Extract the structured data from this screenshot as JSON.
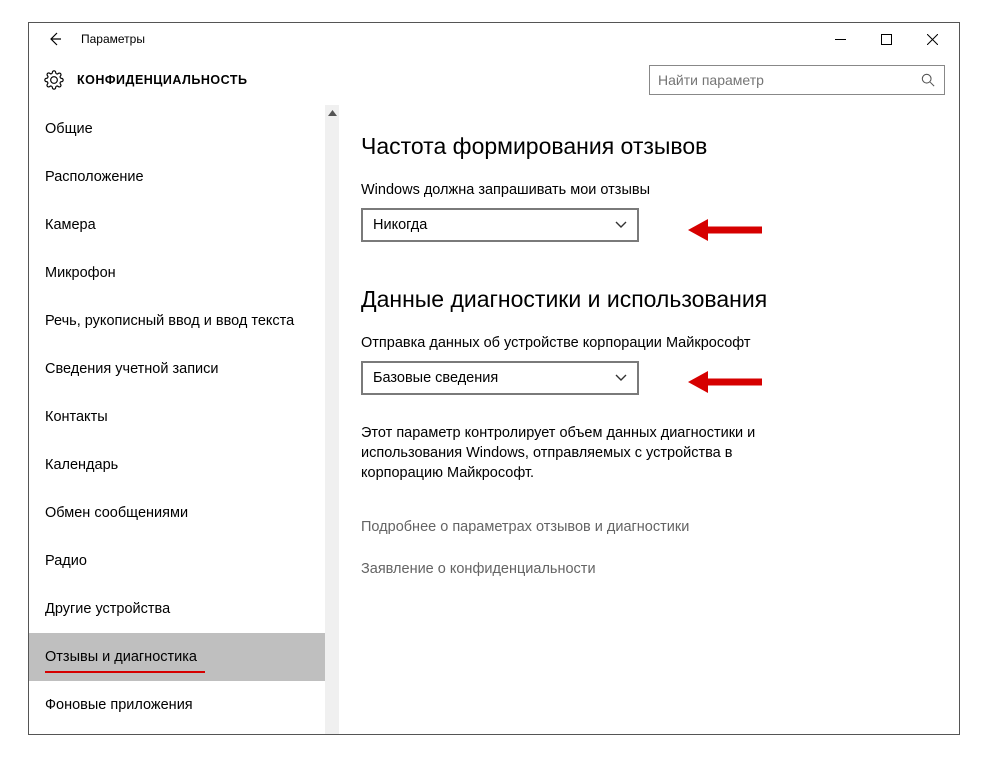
{
  "window_title": "Параметры",
  "header": {
    "title": "КОНФИДЕНЦИАЛЬНОСТЬ"
  },
  "search": {
    "placeholder": "Найти параметр"
  },
  "sidebar": {
    "items": [
      {
        "label": "Общие"
      },
      {
        "label": "Расположение"
      },
      {
        "label": "Камера"
      },
      {
        "label": "Микрофон"
      },
      {
        "label": "Речь, рукописный ввод и ввод текста"
      },
      {
        "label": "Сведения учетной записи"
      },
      {
        "label": "Контакты"
      },
      {
        "label": "Календарь"
      },
      {
        "label": "Обмен сообщениями"
      },
      {
        "label": "Радио"
      },
      {
        "label": "Другие устройства"
      },
      {
        "label": "Отзывы и диагностика"
      },
      {
        "label": "Фоновые приложения"
      }
    ],
    "active_index": 11
  },
  "content": {
    "section1_title": "Частота формирования отзывов",
    "select1_label": "Windows должна запрашивать мои отзывы",
    "select1_value": "Никогда",
    "section2_title": "Данные диагностики и использования",
    "select2_label": "Отправка данных об устройстве корпорации Майкрософт",
    "select2_value": "Базовые сведения",
    "explain": "Этот параметр контролирует объем данных диагностики и использования Windows, отправляемых с устройства в корпорацию Майкрософт.",
    "link1": "Подробнее о параметрах отзывов и диагностики",
    "link2": "Заявление о конфиденциальности"
  }
}
